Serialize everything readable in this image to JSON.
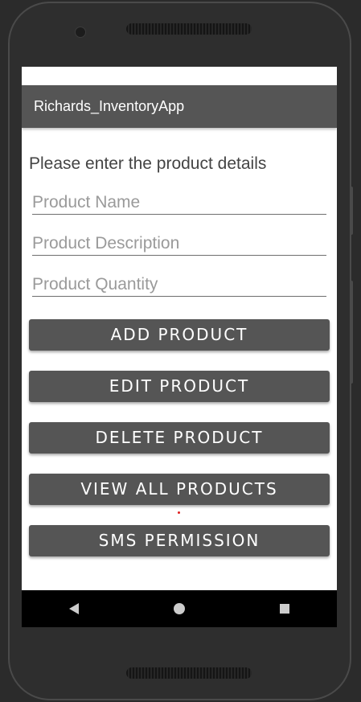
{
  "app_bar": {
    "title": "Richards_InventoryApp"
  },
  "form": {
    "prompt": "Please enter the product details",
    "fields": [
      {
        "placeholder": "Product Name",
        "value": ""
      },
      {
        "placeholder": "Product Description",
        "value": ""
      },
      {
        "placeholder": "Product Quantity",
        "value": ""
      }
    ]
  },
  "buttons": {
    "add": "ADD PRODUCT",
    "edit": "EDIT PRODUCT",
    "delete": "DELETE PRODUCT",
    "view_all": "VIEW ALL PRODUCTS",
    "sms": "SMS PERMISSION"
  },
  "nav": {
    "back": "back-icon",
    "home": "home-icon",
    "recents": "recents-icon"
  },
  "colors": {
    "app_bar": "#555555",
    "button": "#555555",
    "nav_bar": "#000000",
    "accent_dot": "#e02020"
  }
}
